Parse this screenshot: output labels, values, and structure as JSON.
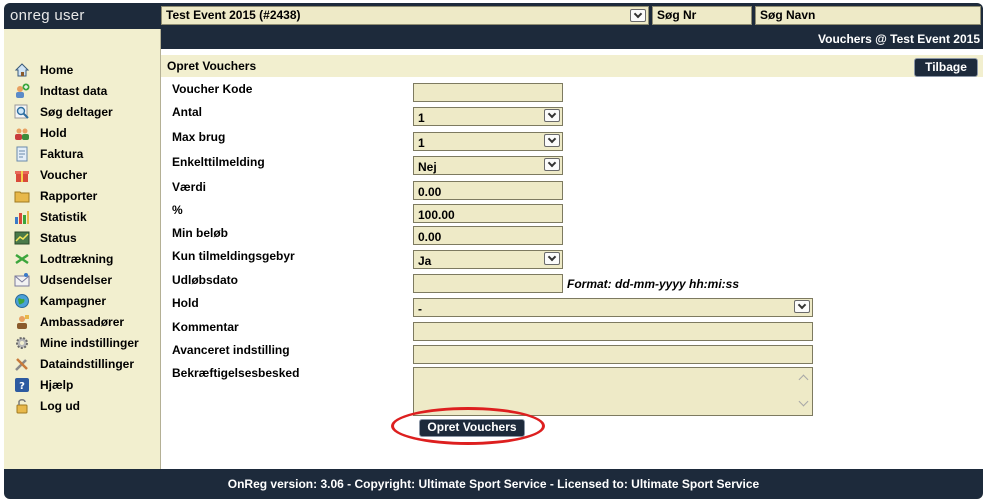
{
  "brand": "onreg user",
  "event_select": "Test Event 2015 (#2438)",
  "search_nr_placeholder": "Søg Nr",
  "search_navn_placeholder": "Søg Navn",
  "page_title": "Vouchers @ Test Event 2015",
  "sidebar": {
    "items": [
      {
        "label": "Home",
        "icon": "home-icon"
      },
      {
        "label": "Indtast data",
        "icon": "add-user-icon"
      },
      {
        "label": "Søg deltager",
        "icon": "search-icon"
      },
      {
        "label": "Hold",
        "icon": "group-icon"
      },
      {
        "label": "Faktura",
        "icon": "invoice-icon"
      },
      {
        "label": "Voucher",
        "icon": "gift-icon"
      },
      {
        "label": "Rapporter",
        "icon": "folder-icon"
      },
      {
        "label": "Statistik",
        "icon": "bar-chart-icon"
      },
      {
        "label": "Status",
        "icon": "status-icon"
      },
      {
        "label": "Lodtrækning",
        "icon": "shuffle-icon"
      },
      {
        "label": "Udsendelser",
        "icon": "mail-icon"
      },
      {
        "label": "Kampagner",
        "icon": "globe-icon"
      },
      {
        "label": "Ambassadører",
        "icon": "ambassador-icon"
      },
      {
        "label": "Mine indstillinger",
        "icon": "gear-icon"
      },
      {
        "label": "Dataindstillinger",
        "icon": "tools-icon"
      },
      {
        "label": "Hjælp",
        "icon": "help-icon"
      },
      {
        "label": "Log ud",
        "icon": "lock-icon"
      }
    ]
  },
  "section_title": "Opret Vouchers",
  "back_label": "Tilbage",
  "form": {
    "voucher_kode": {
      "label": "Voucher Kode",
      "value": ""
    },
    "antal": {
      "label": "Antal",
      "value": "1"
    },
    "max_brug": {
      "label": "Max brug",
      "value": "1"
    },
    "enkelttilmelding": {
      "label": "Enkelttilmelding",
      "value": "Nej"
    },
    "vaerdi": {
      "label": "Værdi",
      "value": "0.00"
    },
    "pct": {
      "label": "%",
      "value": "100.00"
    },
    "min_beloeb": {
      "label": "Min beløb",
      "value": "0.00"
    },
    "kun_tilmeldingsgebyr": {
      "label": "Kun tilmeldingsgebyr",
      "value": "Ja"
    },
    "udloebsdato": {
      "label": "Udløbsdato",
      "value": "",
      "hint": "Format: dd-mm-yyyy hh:mi:ss"
    },
    "hold": {
      "label": "Hold",
      "value": "-"
    },
    "kommentar": {
      "label": "Kommentar",
      "value": ""
    },
    "avanceret": {
      "label": "Avanceret indstilling",
      "value": ""
    },
    "bekraeftelse": {
      "label": "Bekræftigelsesbesked",
      "value": ""
    }
  },
  "submit_label": "Opret Vouchers",
  "footer": "OnReg version: 3.06 - Copyright: Ultimate Sport Service - Licensed to: Ultimate Sport Service",
  "colors": {
    "navy": "#1d2a3b",
    "cream": "#f2efcf",
    "field": "#eeeac7",
    "highlight": "#dd1f1f"
  }
}
